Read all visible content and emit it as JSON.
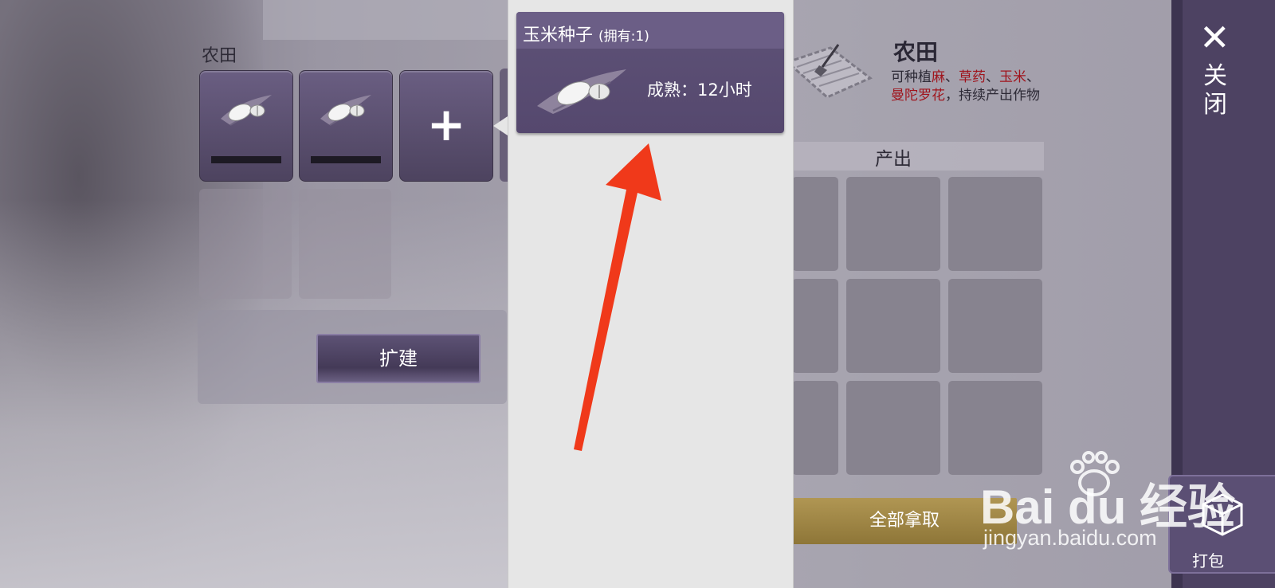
{
  "left_panel": {
    "section_label": "农田",
    "slots": [
      {
        "type": "seed",
        "icon": "corn-seed-icon"
      },
      {
        "type": "seed",
        "icon": "corn-seed-icon"
      },
      {
        "type": "add",
        "symbol": "+"
      }
    ],
    "expand_button": "扩建"
  },
  "popup": {
    "seed_name": "玉米种子",
    "seed_owned": "(拥有:1)",
    "mature_text": "成熟：12小时",
    "icon": "corn-seed-icon"
  },
  "right_panel": {
    "title": "农田",
    "desc_prefix": "可种植",
    "crops": [
      "麻",
      "草药",
      "玉米",
      "曼陀罗花"
    ],
    "separator": "、",
    "desc_suffix": "，持续产出作物",
    "output_label": "产出",
    "collect_all_button": "全部拿取",
    "accent_red": "#a0141c"
  },
  "sidebar": {
    "close_label": "关闭",
    "close_icon": "close-icon",
    "pack_label": "打包",
    "pack_icon": "box-icon"
  },
  "watermark": {
    "brand": "Bai du 经验",
    "url": "jingyan.baidu.com"
  },
  "annotation": {
    "type": "red-arrow",
    "color": "#f0391a"
  }
}
